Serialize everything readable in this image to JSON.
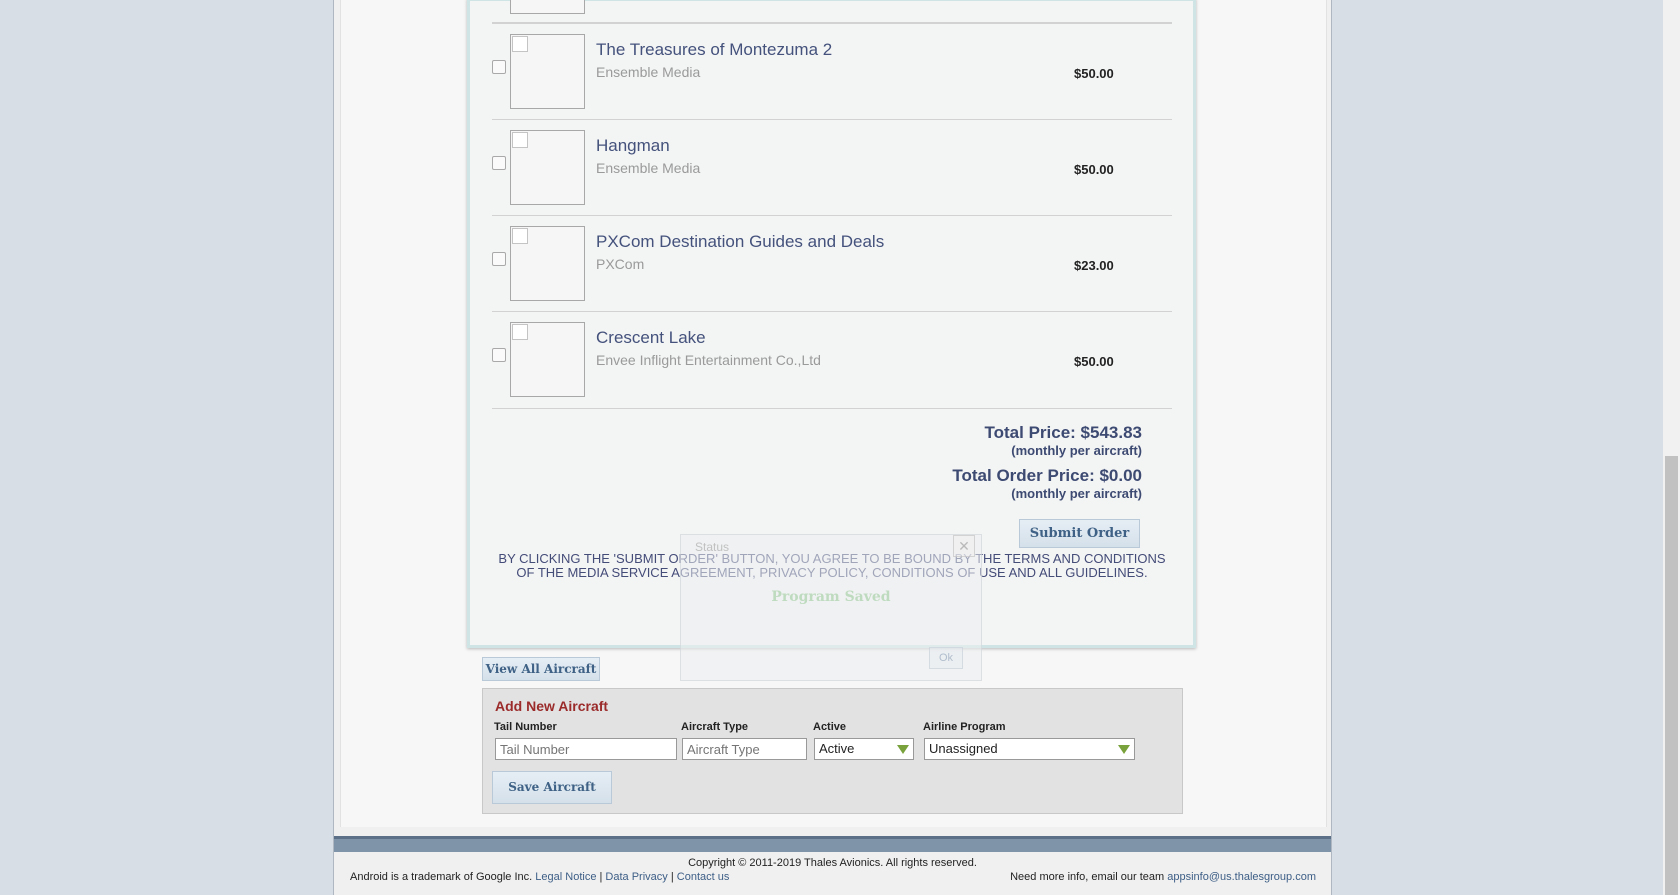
{
  "items": [
    {
      "title": "The Treasures of Montezuma 2",
      "vendor": "Ensemble Media",
      "price": "$50.00"
    },
    {
      "title": "Hangman",
      "vendor": "Ensemble Media",
      "price": "$50.00"
    },
    {
      "title": "PXCom Destination Guides and Deals",
      "vendor": "PXCom",
      "price": "$23.00"
    },
    {
      "title": "Crescent Lake",
      "vendor": "Envee Inflight Entertainment Co.,Ltd",
      "price": "$50.00"
    }
  ],
  "totals": {
    "total_price": "Total Price: $543.83",
    "total_price_note": "(monthly per aircraft)",
    "total_order_price": "Total Order Price: $0.00",
    "total_order_note": "(monthly per aircraft)"
  },
  "submit_label": "Submit Order",
  "terms": "BY CLICKING THE 'SUBMIT ORDER' BUTTON, YOU AGREE TO BE BOUND BY THE TERMS AND CONDITIONS OF THE MEDIA SERVICE AGREEMENT, PRIVACY POLICY, CONDITIONS OF USE AND ALL GUIDELINES.",
  "dialog": {
    "title": "Status",
    "close": "✕",
    "message": "Program Saved",
    "ok": "Ok"
  },
  "view_all_label": "View All Aircraft",
  "add_aircraft": {
    "heading": "Add New Aircraft",
    "tail_label": "Tail Number",
    "tail_placeholder": "Tail Number",
    "type_label": "Aircraft Type",
    "type_placeholder": "Aircraft Type",
    "active_label": "Active",
    "active_value": "Active",
    "program_label": "Airline Program",
    "program_value": "Unassigned",
    "save_label": "Save Aircraft"
  },
  "footer": {
    "copyright": "Copyright © 2011-2019 Thales Avionics. All rights reserved.",
    "android_note": "Android is a trademark of Google Inc.",
    "legal": "Legal Notice",
    "sep1": " | ",
    "privacy": "Data Privacy",
    "sep2": " | ",
    "contact": "Contact us",
    "info_text": "Need more info, email our team",
    "email": "appsinfo@us.thalesgroup.com"
  },
  "colors": {
    "title_blue": "#44527c",
    "heading_red": "#9b2b2b",
    "select_arrow_green": "#7aa23c"
  }
}
